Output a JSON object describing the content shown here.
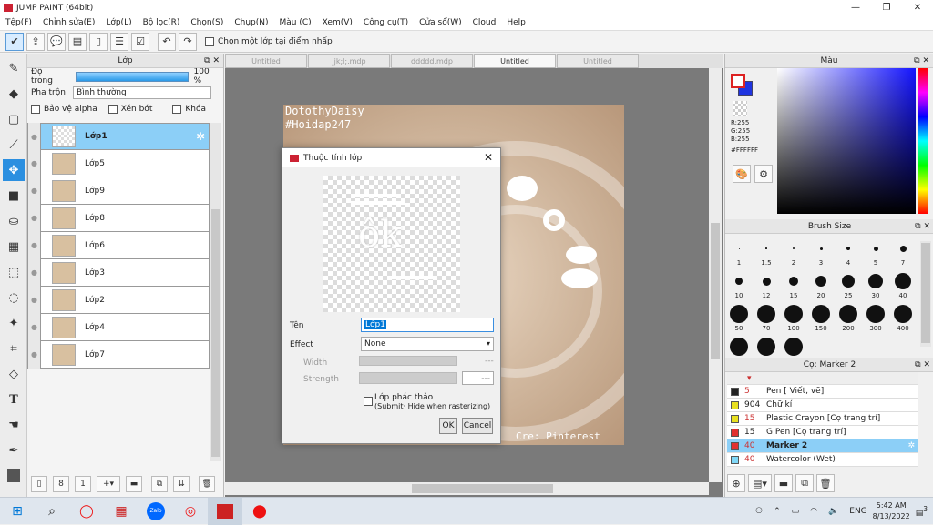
{
  "app": {
    "title": "JUMP PAINT (64bit)"
  },
  "window": {
    "min": "—",
    "restore": "❐",
    "close": "✕"
  },
  "menu": [
    "Tệp(F)",
    "Chỉnh sửa(E)",
    "Lớp(L)",
    "Bộ lọc(R)",
    "Chọn(S)",
    "Chụp(N)",
    "Màu (C)",
    "Xem(V)",
    "Công cụ(T)",
    "Cửa sổ(W)",
    "Cloud",
    "Help"
  ],
  "toolbar": {
    "pick_layer_label": "Chọn một lớp tại điểm nhấp"
  },
  "layer_panel": {
    "title": "Lớp",
    "opacity_label": "Độ trong",
    "opacity_value": "100 %",
    "blend_label": "Pha trộn",
    "blend_value": "Bình thường",
    "protect_alpha": "Bảo vệ alpha",
    "clipping": "Xén bớt",
    "lock": "Khóa",
    "layers": [
      "Lớp1",
      "Lớp5",
      "Lớp9",
      "Lớp8",
      "Lớp6",
      "Lớp3",
      "Lớp2",
      "Lớp4",
      "Lớp7"
    ]
  },
  "tabs": [
    "Untitled",
    "jjk;l;.mdp",
    "ddddd.mdp",
    "Untitled",
    "Untitled"
  ],
  "canvas": {
    "text_top1": "DotothyDaisy",
    "text_top2": "#Hoidap247",
    "text_bottom": "Cre: Pinterest"
  },
  "dialog": {
    "title": "Thuộc tính lớp",
    "name_label": "Tên",
    "name_value": "Lớp1",
    "effect_label": "Effect",
    "effect_value": "None",
    "width_label": "Width",
    "width_value": "---",
    "strength_label": "Strength",
    "strength_value": "---",
    "draft_label": "Lớp phác thảo",
    "draft_sub": "(Submit· Hide when rasterizing)",
    "ok": "OK",
    "cancel": "Cancel",
    "preview_text": "ôk"
  },
  "color_panel": {
    "title": "Màu",
    "r": "R:255",
    "g": "G:255",
    "b": "B:255",
    "hex": "#FFFFFF",
    "accent": "#1414ff"
  },
  "brush_panel": {
    "title": "Brush Size",
    "sizes": [
      "1",
      "1.5",
      "2",
      "3",
      "4",
      "5",
      "7",
      "10",
      "12",
      "15",
      "20",
      "25",
      "30",
      "40",
      "50",
      "70",
      "100",
      "150",
      "200",
      "300",
      "400",
      "",
      "",
      ""
    ]
  },
  "pen_panel": {
    "title": "Cọ: Marker 2",
    "pens": [
      {
        "size": "5",
        "name": "Pen [ Viết, vẽ]",
        "color": "#222222"
      },
      {
        "size": "904",
        "name": "Chữ kí",
        "color": "#e8e020"
      },
      {
        "size": "15",
        "name": "Plastic Crayon [Cọ trang trí]",
        "color": "#e8e020"
      },
      {
        "size": "15",
        "name": "G Pen [Cọ trang trí]",
        "color": "#e03030"
      },
      {
        "size": "40",
        "name": "Marker 2",
        "color": "#e03030"
      },
      {
        "size": "40",
        "name": "Watercolor (Wet)",
        "color": "#80d8f8"
      }
    ]
  },
  "taskbar": {
    "lang": "ENG",
    "time": "5:42 AM",
    "date": "8/13/2022",
    "zalo": "Zalo",
    "notif": "3"
  }
}
